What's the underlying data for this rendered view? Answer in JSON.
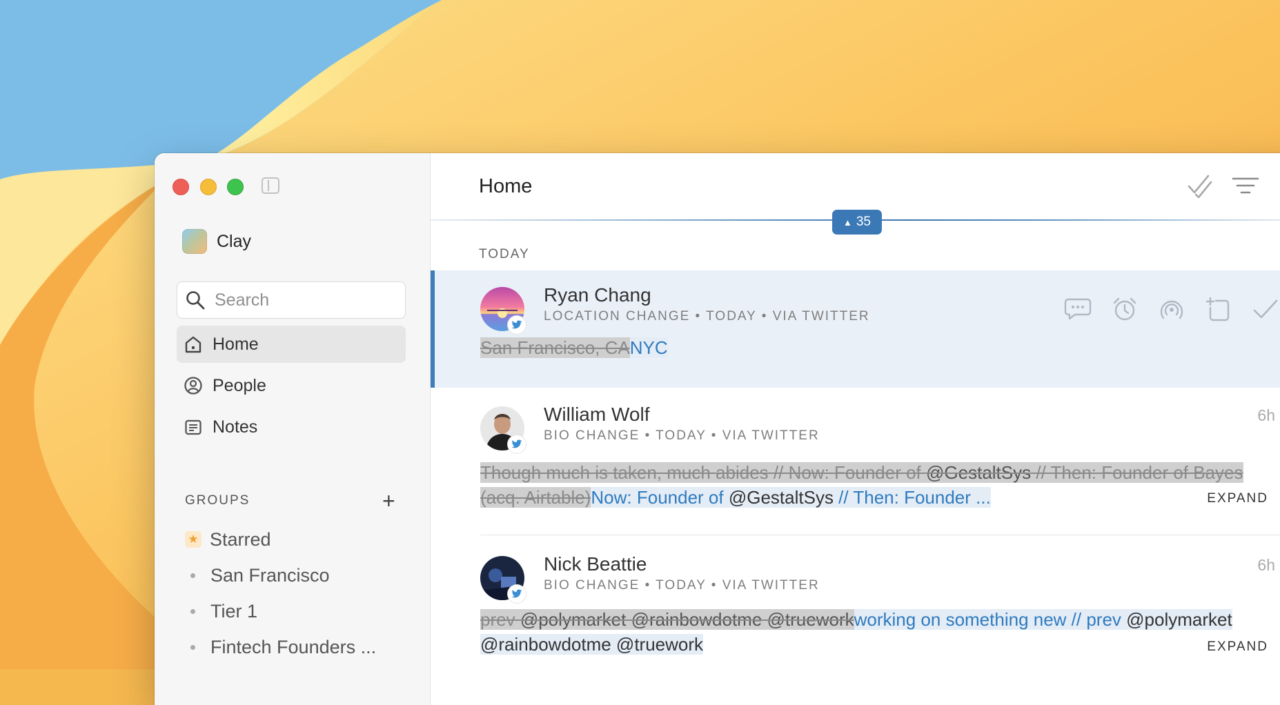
{
  "app": {
    "workspace_name": "Clay"
  },
  "sidebar": {
    "search_placeholder": "Search",
    "nav": [
      {
        "label": "Home",
        "icon": "home-icon",
        "active": true
      },
      {
        "label": "People",
        "icon": "person-circle-icon"
      },
      {
        "label": "Notes",
        "icon": "notes-icon"
      }
    ],
    "groups_title": "GROUPS",
    "groups_add": "+",
    "groups": [
      {
        "label": "Starred",
        "icon": "star-icon"
      },
      {
        "label": "San Francisco"
      },
      {
        "label": "Tier 1"
      },
      {
        "label": "Fintech Founders ..."
      }
    ]
  },
  "main": {
    "title": "Home",
    "new_count": "35",
    "section": "TODAY",
    "entries": [
      {
        "name": "Ryan Chang",
        "meta": "LOCATION CHANGE • TODAY • VIA TWITTER",
        "time": "",
        "old_text": "San Francisco, CA",
        "new_text": "NYC",
        "selected": true
      },
      {
        "name": "William Wolf",
        "meta": "BIO CHANGE • TODAY • VIA TWITTER",
        "time": "6h",
        "old_a": "Though much is taken, much abides // Now: Founder of ",
        "old_mention": "@GestaltSys",
        "old_b": " // Then: Founder of Bayes (acq. Airtable)",
        "new_a": "Now: Founder of ",
        "new_mention": "@GestaltSys",
        "new_b": " // Then: Founder ...",
        "expand": "EXPAND"
      },
      {
        "name": "Nick Beattie",
        "meta": "BIO CHANGE • TODAY • VIA TWITTER",
        "time": "6h",
        "old_a": "prev ",
        "old_mention": "@polymarket @rainbowdotme @truework",
        "new_a": "working on something new // prev ",
        "new_mention": "@polymarket @rainbowdotme @truework",
        "expand": "EXPAND"
      }
    ]
  },
  "colors": {
    "accent": "#3b79b6",
    "selected_bg": "#eaf0f8",
    "new_text": "#2e7bbf",
    "old_bg": "#cfcfcf"
  }
}
